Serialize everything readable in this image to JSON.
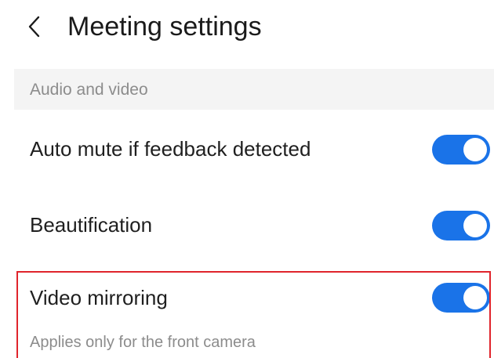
{
  "header": {
    "back_icon": "chevron-left-icon",
    "title": "Meeting settings"
  },
  "section": {
    "label": "Audio and video"
  },
  "settings": [
    {
      "label": "Auto mute if feedback detected",
      "enabled": true
    },
    {
      "label": "Beautification",
      "enabled": true
    },
    {
      "label": "Video mirroring",
      "enabled": true,
      "subtitle": "Applies only for the front camera"
    }
  ],
  "colors": {
    "toggle_on": "#1a73e8",
    "highlight_border": "#e0242c",
    "section_bg": "#f4f4f4",
    "secondary_text": "#8c8c8c"
  }
}
